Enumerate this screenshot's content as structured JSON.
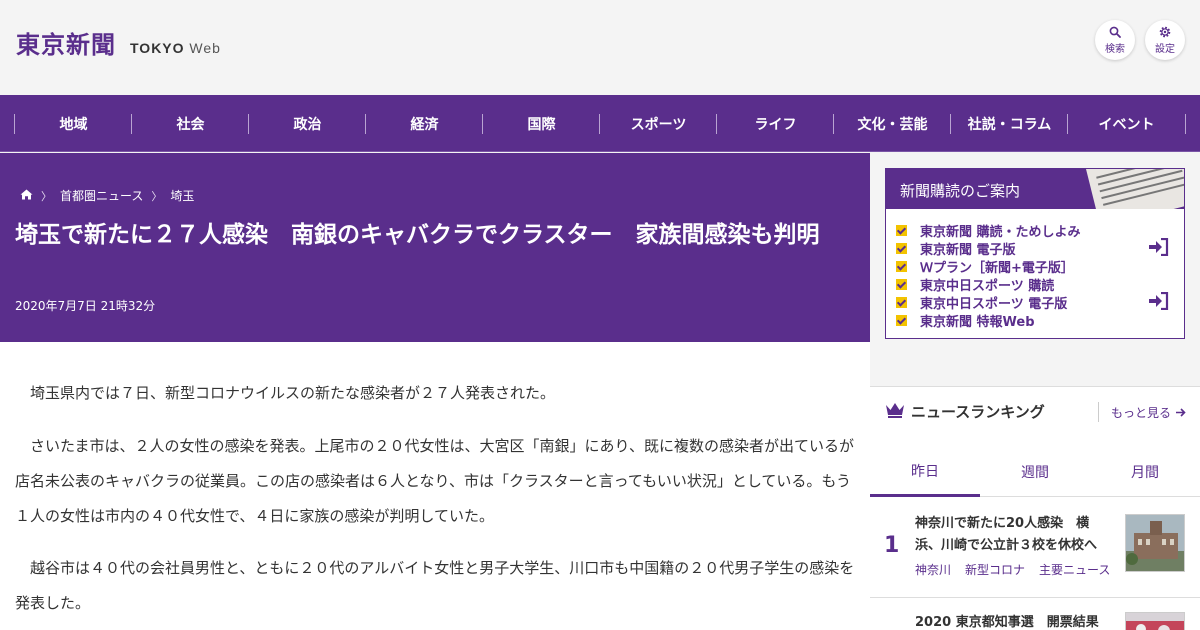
{
  "header": {
    "logo_jp": "東京新聞",
    "logo_en_bold": "TOKYO",
    "logo_en_light": "Web",
    "search_label": "検索",
    "settings_label": "設定"
  },
  "nav": {
    "items": [
      "地域",
      "社会",
      "政治",
      "経済",
      "国際",
      "スポーツ",
      "ライフ",
      "文化・芸能",
      "社説・コラム",
      "イベント"
    ]
  },
  "breadcrumb": {
    "items": [
      "首都圏ニュース",
      "埼玉"
    ]
  },
  "article": {
    "title": "埼玉で新たに２７人感染　南銀のキャバクラでクラスター　家族間感染も判明",
    "date": "2020年7月7日 21時32分",
    "paragraphs": [
      "　埼玉県内では７日、新型コロナウイルスの新たな感染者が２７人発表された。",
      "　さいたま市は、２人の女性の感染を発表。上尾市の２０代女性は、大宮区「南銀」にあり、既に複数の感染者が出ているが店名未公表のキャバクラの従業員。この店の感染者は６人となり、市は「クラスターと言ってもいい状況」としている。もう１人の女性は市内の４０代女性で、４日に家族の感染が判明していた。",
      "　越谷市は４０代の会社員男性と、ともに２０代のアルバイト女性と男子大学生、川口市も中国籍の２０代男子学生の感染を発表した。"
    ]
  },
  "subscription": {
    "heading": "新聞購読のご案内",
    "items": [
      "東京新聞 購読・ためしよみ",
      "東京新聞 電子版",
      "Ｗプラン［新聞+電子版］",
      "東京中日スポーツ 購読",
      "東京中日スポーツ 電子版",
      "東京新聞 特報Web"
    ]
  },
  "ranking": {
    "heading": "ニュースランキング",
    "more": "もっと見る",
    "tabs": [
      "昨日",
      "週間",
      "月間"
    ],
    "items": [
      {
        "rank": "1",
        "title": "神奈川で新たに20人感染　横浜、川崎で公立計３校を休校へ",
        "tags": [
          "神奈川",
          "新型コロナ",
          "主要ニュース"
        ]
      },
      {
        "rank": "",
        "title": "2020 東京都知事選　開票結果",
        "tags": []
      }
    ]
  },
  "colors": {
    "brand": "#5a2e8c",
    "accent": "#f3c300"
  }
}
